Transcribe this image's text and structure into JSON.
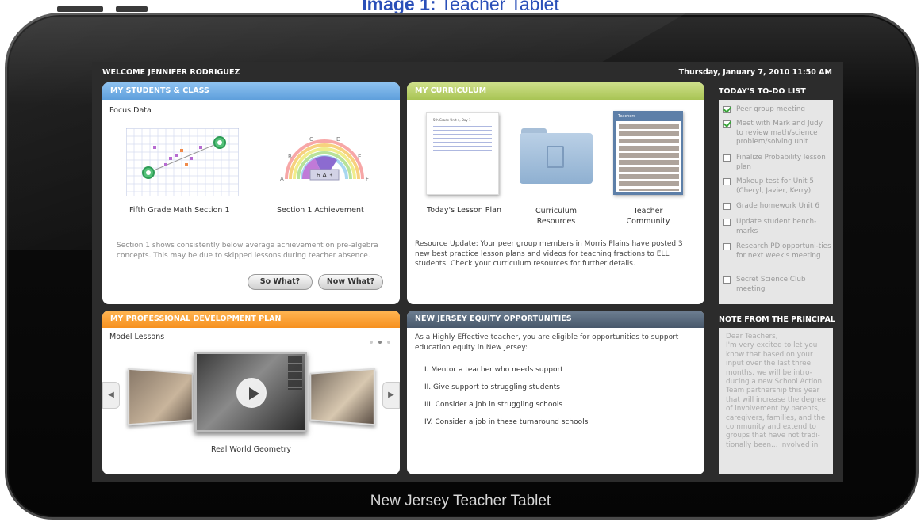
{
  "caption": {
    "bold": "Image 1:",
    "rest": " Teacher Tablet"
  },
  "tablet_label": "New Jersey Teacher Tablet",
  "topbar": {
    "welcome": "WELCOME JENNIFER RODRIGUEZ",
    "datetime": "Thursday, January 7, 2010   11:50 AM"
  },
  "students": {
    "header": "MY STUDENTS & CLASS",
    "focus_label": "Focus Data",
    "chart1_caption": "Fifth Grade Math Section 1",
    "chart2_caption": "Section 1 Achievement",
    "gauge_value": "6.A.3",
    "gauge_letters": [
      "A",
      "B",
      "C",
      "D",
      "E",
      "F"
    ],
    "summary": "Section 1 shows consistently below average achievement on pre-algebra concepts. This may be due to skipped lessons during teacher absence.",
    "so_what_button": "So What?",
    "now_what_button": "Now What?"
  },
  "curriculum": {
    "header": "MY CURRICULUM",
    "doc_title": "5th Grade Unit 4, Day 1",
    "community_title": "Teachers",
    "items": [
      {
        "label": "Today's Lesson Plan"
      },
      {
        "label": "Curriculum\nResources"
      },
      {
        "label": "Teacher\nCommunity"
      }
    ],
    "update": "Resource Update: Your peer group members in Morris Plains have posted 3 new best practice lesson plans and videos for teaching fractions to ELL students. Check your curriculum resources for further details."
  },
  "todo": {
    "header": "TODAY'S TO-DO LIST",
    "items": [
      {
        "label": "Peer group meeting",
        "checked": true
      },
      {
        "label": "Meet with Mark and Judy to review math/science problem/solving unit",
        "checked": true
      },
      {
        "label": "Finalize Probability lesson plan",
        "checked": false
      },
      {
        "label": "Makeup test for Unit 5 (Cheryl, Javier, Kerry)",
        "checked": false
      },
      {
        "label": "Grade homework Unit 6",
        "checked": false
      },
      {
        "label": "Update student bench-marks",
        "checked": false
      },
      {
        "label": "Research PD opportuni-ties for next week's meeting",
        "checked": false
      },
      {
        "label": "Secret Science Club meeting",
        "checked": false
      }
    ]
  },
  "pd": {
    "header": "MY PROFESSIONAL DEVELOPMENT PLAN",
    "model_lessons": "Model Lessons",
    "video_caption": "Real World Geometry"
  },
  "equity": {
    "header": "NEW JERSEY EQUITY OPPORTUNITIES",
    "intro": "As a Highly Effective teacher, you are eligible for opportunities to support education equity in New Jersey:",
    "items": [
      "I. Mentor a teacher who needs support",
      "II. Give support to struggling students",
      "III. Consider a job in struggling schools",
      "IV. Consider a job in these turnaround schools"
    ]
  },
  "note": {
    "header": "NOTE FROM THE PRINCIPAL",
    "text": "Dear Teachers,\nI'm very excited to let you know that based on your input over the last three months, we will be intro-ducing a new School Action Team partnership this year that will increase the degree of involvement by parents, caregivers, families, and the community and extend to groups that have not tradi-tionally been... involved in"
  },
  "colors": {
    "blue_header": "#5e9fdc",
    "green_header": "#a8c454",
    "orange_header": "#f6901f",
    "slate_header": "#48586b"
  }
}
